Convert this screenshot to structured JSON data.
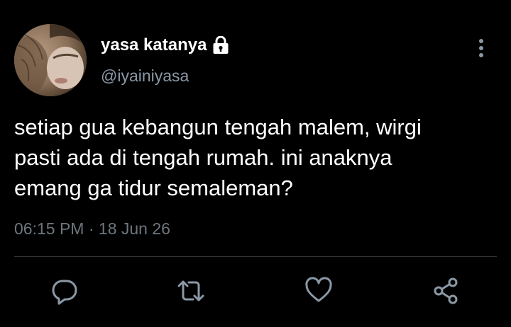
{
  "tweet": {
    "display_name": "yasa katanya",
    "handle": "@iyainiyasa",
    "text": "setiap gua kebangun tengah malem, wirgi\npasti ada di tengah rumah. ini anaknya\nemang ga tidur semaleman?",
    "time": "06:15 PM",
    "separator": "·",
    "date": "18 Jun 26",
    "protected_icon": "lock-icon",
    "more_icon": "more-vertical-icon"
  },
  "actions": [
    {
      "icon": "reply-icon"
    },
    {
      "icon": "retweet-icon"
    },
    {
      "icon": "like-icon"
    },
    {
      "icon": "share-icon"
    }
  ],
  "colors": {
    "background": "#000000",
    "primary_text": "#ffffff",
    "secondary_text": "#8b98a5",
    "meta_text": "#6e767d",
    "icon": "#8b98a5",
    "divider": "#2f3336"
  }
}
